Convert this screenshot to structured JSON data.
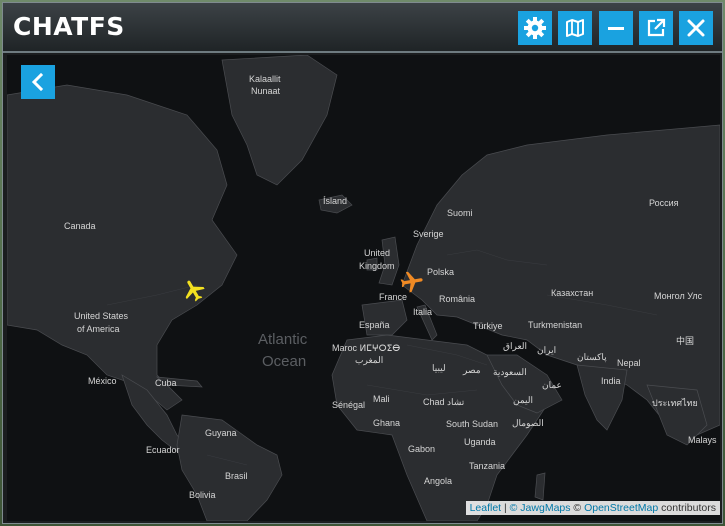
{
  "app": {
    "title": "CHATFS"
  },
  "toolbar": {
    "buttons": [
      {
        "name": "settings",
        "icon": "gear-icon"
      },
      {
        "name": "map",
        "icon": "map-icon"
      },
      {
        "name": "minimize",
        "icon": "minus-icon"
      },
      {
        "name": "popout",
        "icon": "external-link-icon"
      },
      {
        "name": "close",
        "icon": "close-icon"
      }
    ],
    "accent": "#1aa2e0"
  },
  "map": {
    "back_icon": "chevron-left-icon",
    "labels": {
      "kalaallit": "Kalaallit",
      "nunaat": "Nunaat",
      "island": "Ísland",
      "canada": "Canada",
      "suomi": "Suomi",
      "rossiya": "Россия",
      "sverige": "Sverige",
      "uk1": "United",
      "uk2": "Kingdom",
      "polska": "Polska",
      "us1": "United States",
      "us2": "of America",
      "france": "France",
      "romania": "România",
      "kazakhstan": "Казахстан",
      "mongol": "Монгол Улс",
      "italia": "Italia",
      "espana": "España",
      "turkiye": "Türkiye",
      "turkmenistan": "Turkmenistan",
      "zhongguo": "中国",
      "maroc": "Maroc ⵍⵎⵖⵔⵉⴱ",
      "maghrib": "المغرب",
      "iraq": "العراق",
      "iran": "ایران",
      "pakistan": "پاکستان",
      "nepal": "Nepal",
      "mexico": "México",
      "cuba": "Cuba",
      "libya": "ليبيا",
      "misr": "مصر",
      "saudi": "السعودية",
      "oman": "عمان",
      "india": "India",
      "thailand": "ประเทศไทย",
      "senegal": "Sénégal",
      "mali": "Mali",
      "chad": "Chad تشاد",
      "yemen": "اليمن",
      "guyana": "Guyana",
      "ghana": "Ghana",
      "south_sudan": "South Sudan",
      "somalia": "الصومال",
      "ecuador": "Ecuador",
      "uganda": "Uganda",
      "gabon": "Gabon",
      "malaysia": "Malays",
      "brasil": "Brasil",
      "tanzania": "Tanzania",
      "angola": "Angola",
      "bolivia": "Bolivia"
    },
    "ocean": {
      "line1": "Atlantic",
      "line2": "Ocean"
    },
    "planes": [
      {
        "color": "#f2e020",
        "icon": "airplane-icon"
      },
      {
        "color": "#f08a24",
        "icon": "airplane-icon"
      }
    ]
  },
  "attribution": {
    "leaflet": "Leaflet",
    "sep1": " | ",
    "jawg": "© JawgMaps",
    "sep2": " © ",
    "osm": "OpenStreetMap",
    "tail": " contributors"
  }
}
